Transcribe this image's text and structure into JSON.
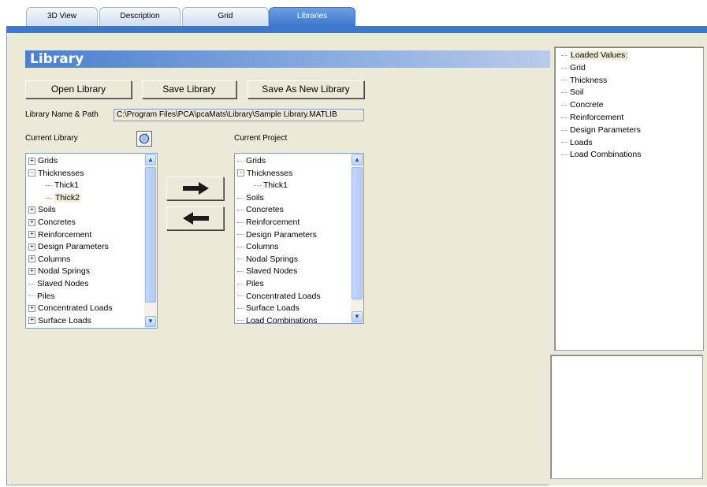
{
  "tabs": [
    {
      "label": "3D View",
      "active": false
    },
    {
      "label": "Description",
      "active": false
    },
    {
      "label": "Grid",
      "active": false
    },
    {
      "label": "Libraries",
      "active": true
    }
  ],
  "library": {
    "title": "Library",
    "open_button": "Open Library",
    "save_button": "Save Library",
    "save_as_new_button": "Save As New Library",
    "path_label": "Library Name & Path",
    "path_value": "C:\\Program Files\\PCA\\pcaMats\\Library\\Sample Library.MATLIB",
    "current_library_label": "Current Library",
    "current_project_label": "Current Project"
  },
  "current_library_tree": [
    {
      "label": "Grids",
      "expander": "+",
      "level": 0
    },
    {
      "label": "Thicknesses",
      "expander": "-",
      "level": 0
    },
    {
      "label": "Thick1",
      "expander": "",
      "level": 1
    },
    {
      "label": "Thick2",
      "expander": "",
      "level": 1,
      "selected": true
    },
    {
      "label": "Soils",
      "expander": "+",
      "level": 0
    },
    {
      "label": "Concretes",
      "expander": "+",
      "level": 0
    },
    {
      "label": "Reinforcement",
      "expander": "+",
      "level": 0
    },
    {
      "label": "Design Parameters",
      "expander": "+",
      "level": 0
    },
    {
      "label": "Columns",
      "expander": "+",
      "level": 0
    },
    {
      "label": "Nodal Springs",
      "expander": "+",
      "level": 0
    },
    {
      "label": "Slaved Nodes",
      "expander": "",
      "level": 0
    },
    {
      "label": "Piles",
      "expander": "",
      "level": 0
    },
    {
      "label": "Concentrated Loads",
      "expander": "+",
      "level": 0
    },
    {
      "label": "Surface Loads",
      "expander": "+",
      "level": 0
    }
  ],
  "current_project_tree": [
    {
      "label": "Grids",
      "expander": "",
      "level": 0
    },
    {
      "label": "Thicknesses",
      "expander": "-",
      "level": 0
    },
    {
      "label": "Thick1",
      "expander": "",
      "level": 1
    },
    {
      "label": "Soils",
      "expander": "",
      "level": 0
    },
    {
      "label": "Concretes",
      "expander": "",
      "level": 0
    },
    {
      "label": "Reinforcement",
      "expander": "",
      "level": 0
    },
    {
      "label": "Design Parameters",
      "expander": "",
      "level": 0
    },
    {
      "label": "Columns",
      "expander": "",
      "level": 0
    },
    {
      "label": "Nodal Springs",
      "expander": "",
      "level": 0
    },
    {
      "label": "Slaved Nodes",
      "expander": "",
      "level": 0
    },
    {
      "label": "Piles",
      "expander": "",
      "level": 0
    },
    {
      "label": "Concentrated Loads",
      "expander": "",
      "level": 0
    },
    {
      "label": "Surface Loads",
      "expander": "",
      "level": 0
    },
    {
      "label": "Load Combinations",
      "expander": "",
      "level": 0
    }
  ],
  "loaded_values": [
    {
      "label": "Loaded Values:",
      "level": 0,
      "selected": true
    },
    {
      "label": "Grid",
      "level": 1
    },
    {
      "label": "Thickness",
      "level": 1
    },
    {
      "label": "Soil",
      "level": 1
    },
    {
      "label": "Concrete",
      "level": 1
    },
    {
      "label": "Reinforcement",
      "level": 1
    },
    {
      "label": "Design Parameters",
      "level": 1
    },
    {
      "label": "Loads",
      "level": 1
    },
    {
      "label": "Load Combinations",
      "level": 1
    }
  ],
  "icons": {
    "refresh": "refresh-icon",
    "copy_to_project": "arrow-right-icon",
    "copy_to_library": "arrow-left-icon"
  },
  "colors": {
    "accent": "#3f78cf",
    "panel": "#ece9d8"
  }
}
